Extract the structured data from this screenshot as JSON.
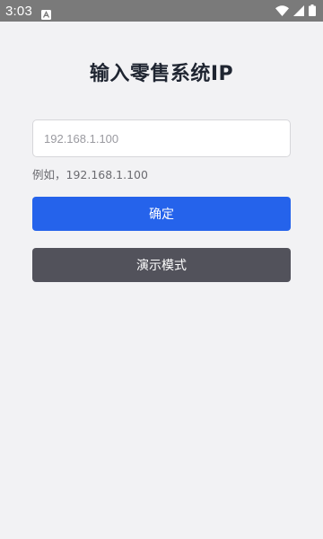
{
  "status_bar": {
    "time": "3:03",
    "notification_icon": "app-notification-icon",
    "icons": [
      "wifi-icon",
      "cellular-signal-icon",
      "battery-icon"
    ]
  },
  "title": "输入零售系统IP",
  "ip_input": {
    "value": "",
    "placeholder": "192.168.1.100"
  },
  "hint": "例如，192.168.1.100",
  "buttons": {
    "confirm_label": "确定",
    "demo_label": "演示模式"
  },
  "colors": {
    "confirm": "#2563eb",
    "demo": "#52525b",
    "background": "#f2f2f4",
    "status_bar": "#7a7a7a"
  }
}
